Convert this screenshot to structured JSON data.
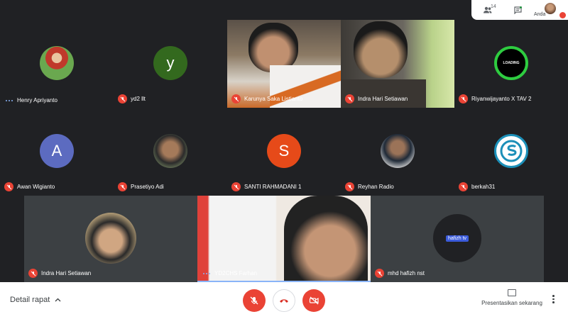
{
  "topbar": {
    "people_count": "14",
    "self_label": "Anda"
  },
  "participants": [
    {
      "name": "Henry Apriyanto",
      "kind": "photo",
      "speaking": true
    },
    {
      "name": "yd2 llt",
      "kind": "initial",
      "initial": "y",
      "color": "#33691e"
    },
    {
      "name": "Karunya Saka Listianto",
      "kind": "video"
    },
    {
      "name": "Indra Hari Setiawan",
      "kind": "video"
    },
    {
      "name": "Riyanwijayanto X TAV 2",
      "kind": "photo",
      "badge": "LOADING"
    },
    {
      "name": "Awan Wigianto",
      "kind": "initial",
      "initial": "A",
      "color": "#5c6bc0"
    },
    {
      "name": "Prasetiyo Adi",
      "kind": "photo"
    },
    {
      "name": "SANTI RAHMADANI 1",
      "kind": "initial",
      "initial": "S",
      "color": "#e64a19"
    },
    {
      "name": "Reyhan Radio",
      "kind": "photo"
    },
    {
      "name": "berkah31",
      "kind": "photo"
    },
    {
      "name": "Indra Hari Setiawan",
      "kind": "photo"
    },
    {
      "name": "YD2CHS Farhan",
      "kind": "video",
      "speaking": true
    },
    {
      "name": "mhd hafizh nst",
      "kind": "photo",
      "badge": "hafizh tv"
    }
  ],
  "bottombar": {
    "meeting_details": "Detail rapat",
    "present_now": "Presentasikan sekarang"
  },
  "colors": {
    "mic_off": "#ea4335",
    "background": "#202124",
    "tile": "#3c4043"
  }
}
